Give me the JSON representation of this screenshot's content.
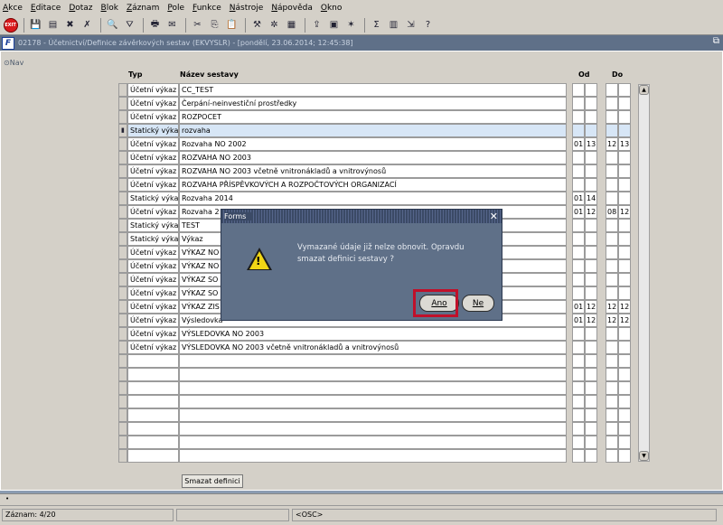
{
  "menu": [
    "Akce",
    "Editace",
    "Dotaz",
    "Blok",
    "Záznam",
    "Pole",
    "Funkce",
    "Nástroje",
    "Nápověda",
    "Okno"
  ],
  "toolbar": {
    "exit_label": "EXIT",
    "icons": [
      "save-icon",
      "new-record-icon",
      "delete-record-icon",
      "delete-icon",
      "find-icon",
      "filter-icon",
      "print-icon",
      "mail-icon",
      "cut-icon",
      "copy-icon",
      "paste-icon",
      "tools-icon",
      "settings-icon",
      "calendar-icon",
      "upload-icon",
      "report-icon",
      "star-icon",
      "sum-icon",
      "excel-icon",
      "export-icon",
      "help-icon"
    ]
  },
  "window": {
    "title": "02178 - Účetnictví/Definice závěrkových sestav (EKVYSLR) - [pondělí, 23.06.2014; 12:45:38]",
    "nav_label": "Nav"
  },
  "table": {
    "headers": {
      "typ": "Typ",
      "nazev": "Název sestavy",
      "od": "Od",
      "do": "Do"
    },
    "rows": [
      {
        "typ": "Účetní výkaz",
        "nazev": "CC_TEST",
        "od1": "",
        "od2": "",
        "do1": "",
        "do2": ""
      },
      {
        "typ": "Účetní výkaz",
        "nazev": "Čerpání-neinvestiční prostředky",
        "od1": "",
        "od2": "",
        "do1": "",
        "do2": ""
      },
      {
        "typ": "Účetní výkaz",
        "nazev": "ROZPOCET",
        "od1": "",
        "od2": "",
        "do1": "",
        "do2": ""
      },
      {
        "typ": "Statický výkaz",
        "nazev": "rozvaha",
        "od1": "",
        "od2": "",
        "do1": "",
        "do2": ""
      },
      {
        "typ": "Účetní výkaz",
        "nazev": "Rozvaha NO 2002",
        "od1": "01",
        "od2": "13",
        "do1": "12",
        "do2": "13"
      },
      {
        "typ": "Účetní výkaz",
        "nazev": "ROZVAHA NO 2003",
        "od1": "",
        "od2": "",
        "do1": "",
        "do2": ""
      },
      {
        "typ": "Účetní výkaz",
        "nazev": "ROZVAHA NO 2003 včetně vnitronákladů a vnitrovýnosů",
        "od1": "",
        "od2": "",
        "do1": "",
        "do2": ""
      },
      {
        "typ": "Účetní výkaz",
        "nazev": "ROZVAHA PŘÍSPĚVKOVÝCH A ROZPOČTOVÝCH ORGANIZACÍ",
        "od1": "",
        "od2": "",
        "do1": "",
        "do2": ""
      },
      {
        "typ": "Statický výkaz",
        "nazev": "Rozvaha 2014",
        "od1": "01",
        "od2": "14",
        "do1": "",
        "do2": ""
      },
      {
        "typ": "Účetní výkaz",
        "nazev": "Rozvaha 2",
        "od1": "01",
        "od2": "12",
        "do1": "08",
        "do2": "12"
      },
      {
        "typ": "Statický výkaz",
        "nazev": "TEST",
        "od1": "",
        "od2": "",
        "do1": "",
        "do2": ""
      },
      {
        "typ": "Statický výkaz",
        "nazev": "Výkaz",
        "od1": "",
        "od2": "",
        "do1": "",
        "do2": ""
      },
      {
        "typ": "Účetní výkaz",
        "nazev": "VÝKAZ NO",
        "od1": "",
        "od2": "",
        "do1": "",
        "do2": ""
      },
      {
        "typ": "Účetní výkaz",
        "nazev": "VÝKAZ NO",
        "od1": "",
        "od2": "",
        "do1": "",
        "do2": ""
      },
      {
        "typ": "Účetní výkaz",
        "nazev": "VÝKAZ SO",
        "od1": "",
        "od2": "",
        "do1": "",
        "do2": ""
      },
      {
        "typ": "Účetní výkaz",
        "nazev": "VÝKAZ SO",
        "od1": "",
        "od2": "",
        "do1": "",
        "do2": ""
      },
      {
        "typ": "Účetní výkaz",
        "nazev": "VÝKAZ ZIS",
        "od1": "01",
        "od2": "12",
        "do1": "12",
        "do2": "12"
      },
      {
        "typ": "Účetní výkaz",
        "nazev": "Výsledovka",
        "od1": "01",
        "od2": "12",
        "do1": "12",
        "do2": "12"
      },
      {
        "typ": "Účetní výkaz",
        "nazev": "VÝSLEDOVKA NO 2003",
        "od1": "",
        "od2": "",
        "do1": "",
        "do2": ""
      },
      {
        "typ": "Účetní výkaz",
        "nazev": "VÝSLEDOVKA NO 2003 včetně vnitronákladů a vnitrovýnosů",
        "od1": "",
        "od2": "",
        "do1": "",
        "do2": ""
      },
      {
        "typ": "",
        "nazev": "",
        "od1": "",
        "od2": "",
        "do1": "",
        "do2": ""
      },
      {
        "typ": "",
        "nazev": "",
        "od1": "",
        "od2": "",
        "do1": "",
        "do2": ""
      },
      {
        "typ": "",
        "nazev": "",
        "od1": "",
        "od2": "",
        "do1": "",
        "do2": ""
      },
      {
        "typ": "",
        "nazev": "",
        "od1": "",
        "od2": "",
        "do1": "",
        "do2": ""
      },
      {
        "typ": "",
        "nazev": "",
        "od1": "",
        "od2": "",
        "do1": "",
        "do2": ""
      },
      {
        "typ": "",
        "nazev": "",
        "od1": "",
        "od2": "",
        "do1": "",
        "do2": ""
      },
      {
        "typ": "",
        "nazev": "",
        "od1": "",
        "od2": "",
        "do1": "",
        "do2": ""
      },
      {
        "typ": "",
        "nazev": "",
        "od1": "",
        "od2": "",
        "do1": "",
        "do2": ""
      }
    ],
    "selected_index": 3
  },
  "delete_button": "Smazat definici",
  "dialog": {
    "title": "Forms",
    "message": "Vymazané údaje již nelze obnovit. Opravdu smazat definici sestavy ?",
    "yes_label": "Ano",
    "no_label": "Ne"
  },
  "status": {
    "record": "Záznam: 4/20",
    "mode": "<OSC>"
  }
}
